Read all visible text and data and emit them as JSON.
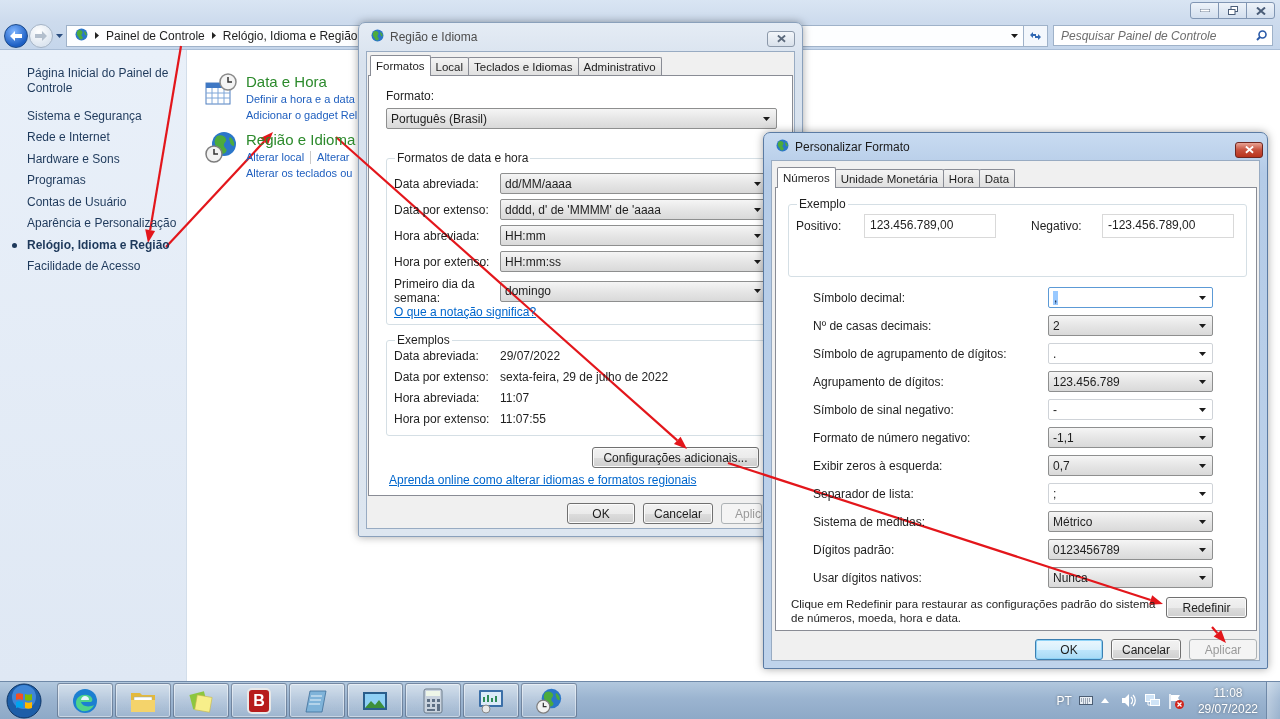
{
  "explorer": {
    "breadcrumbs": [
      "Painel de Controle",
      "Relógio, Idioma e Região"
    ],
    "search": {
      "placeholder": "Pesquisar Painel de Controle"
    },
    "sidebar": {
      "items": [
        {
          "label": "Página Inicial do Painel de Controle",
          "selected": false
        },
        {
          "label": "Sistema e Segurança",
          "selected": false
        },
        {
          "label": "Rede e Internet",
          "selected": false
        },
        {
          "label": "Hardware e Sons",
          "selected": false
        },
        {
          "label": "Programas",
          "selected": false
        },
        {
          "label": "Contas de Usuário",
          "selected": false
        },
        {
          "label": "Aparência e Personalização",
          "selected": false
        },
        {
          "label": "Relógio, Idioma e Região",
          "selected": true
        },
        {
          "label": "Facilidade de Acesso",
          "selected": false
        }
      ]
    },
    "categories": [
      {
        "kind": "date-time",
        "title": "Data e Hora",
        "task_lines": [
          [
            "Definir a hora e a data"
          ],
          [
            "Adicionar o gadget Rel"
          ]
        ]
      },
      {
        "kind": "region",
        "title": "Região e Idioma",
        "task_lines": [
          [
            "Alterar local",
            "Alterar"
          ],
          [
            "Alterar os teclados ou"
          ]
        ]
      }
    ]
  },
  "region_dialog": {
    "title": "Região e Idioma",
    "active": false,
    "tabs": [
      {
        "label": "Formatos",
        "selected": true
      },
      {
        "label": "Local",
        "selected": false
      },
      {
        "label": "Teclados e Idiomas",
        "selected": false
      },
      {
        "label": "Administrativo",
        "selected": false
      }
    ],
    "format": {
      "label": "Formato:",
      "value": "Português (Brasil)"
    },
    "date_time_formats": {
      "title": "Formatos de data e hora",
      "rows": [
        {
          "label": "Data abreviada:",
          "value": "dd/MM/aaaa"
        },
        {
          "label": "Data por extenso:",
          "value": "dddd, d' de 'MMMM' de 'aaaa"
        },
        {
          "label": "Hora abreviada:",
          "value": "HH:mm"
        },
        {
          "label": "Hora por extenso:",
          "value": "HH:mm:ss"
        },
        {
          "label": "Primeiro dia da semana:",
          "value": "domingo"
        }
      ],
      "link": "O que a notação significa?"
    },
    "examples": {
      "title": "Exemplos",
      "rows": [
        {
          "label": "Data abreviada:",
          "value": "29/07/2022"
        },
        {
          "label": "Data por extenso:",
          "value": "sexta-feira, 29 de julho de 2022"
        },
        {
          "label": "Hora abreviada:",
          "value": "11:07"
        },
        {
          "label": "Hora por extenso:",
          "value": "11:07:55"
        }
      ]
    },
    "additional_settings_button": "Configurações adicionais...",
    "online_link": "Aprenda online como alterar idiomas e formatos regionais",
    "buttons": [
      {
        "label": "OK",
        "disabled": false
      },
      {
        "label": "Cancelar",
        "disabled": false
      },
      {
        "label": "Aplic",
        "disabled": true
      }
    ]
  },
  "customize_dialog": {
    "title": "Personalizar Formato",
    "active": true,
    "tabs": [
      {
        "label": "Números",
        "selected": true
      },
      {
        "label": "Unidade Monetária",
        "selected": false
      },
      {
        "label": "Hora",
        "selected": false
      },
      {
        "label": "Data",
        "selected": false
      }
    ],
    "example": {
      "title": "Exemplo",
      "positive": {
        "label": "Positivo:",
        "value": "123.456.789,00"
      },
      "negative": {
        "label": "Negativo:",
        "value": "-123.456.789,00"
      }
    },
    "settings": [
      {
        "label": "Símbolo decimal:",
        "value": ",",
        "kind": "editable",
        "focused": true
      },
      {
        "label": "Nº de casas decimais:",
        "value": "2",
        "kind": "list",
        "focused": false
      },
      {
        "label": "Símbolo de agrupamento de dígitos:",
        "value": ".",
        "kind": "editable",
        "focused": false
      },
      {
        "label": "Agrupamento de dígitos:",
        "value": "123.456.789",
        "kind": "list",
        "focused": false
      },
      {
        "label": "Símbolo de sinal negativo:",
        "value": "-",
        "kind": "editable",
        "focused": false
      },
      {
        "label": "Formato de número negativo:",
        "value": "-1,1",
        "kind": "list",
        "focused": false
      },
      {
        "label": "Exibir zeros à esquerda:",
        "value": "0,7",
        "kind": "list",
        "focused": false
      },
      {
        "label": "Separador de lista:",
        "value": ";",
        "kind": "editable",
        "focused": false
      },
      {
        "label": "Sistema de medidas:",
        "value": "Métrico",
        "kind": "list",
        "focused": false
      },
      {
        "label": "Dígitos padrão:",
        "value": "0123456789",
        "kind": "list",
        "focused": false
      },
      {
        "label": "Usar dígitos nativos:",
        "value": "Nunca",
        "kind": "list",
        "focused": false
      }
    ],
    "reset_note": "Clique em Redefinir para restaurar as configurações padrão do sistema de números, moeda, hora e data.",
    "reset_button": "Redefinir",
    "buttons": [
      {
        "label": "OK",
        "default": true,
        "disabled": false
      },
      {
        "label": "Cancelar",
        "default": false,
        "disabled": false
      },
      {
        "label": "Aplicar",
        "default": false,
        "disabled": true
      }
    ]
  },
  "taskbar": {
    "apps": [
      {
        "kind": "browser"
      },
      {
        "kind": "folder"
      },
      {
        "kind": "notes"
      },
      {
        "kind": "letter",
        "label": "B"
      },
      {
        "kind": "notepad"
      },
      {
        "kind": "picture"
      },
      {
        "kind": "calculator"
      },
      {
        "kind": "control-panel"
      },
      {
        "kind": "globe"
      }
    ],
    "tray": {
      "language": "PT",
      "time": "11:08",
      "date": "29/07/2022"
    }
  }
}
